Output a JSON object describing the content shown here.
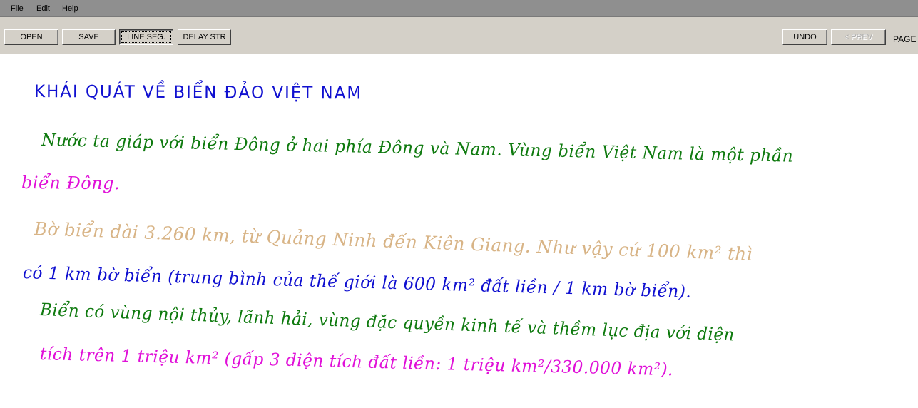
{
  "menu": {
    "file": "File",
    "edit": "Edit",
    "help": "Help"
  },
  "toolbar": {
    "open": "OPEN",
    "save": "SAVE",
    "line_seg": "LINE SEG.",
    "delay_str": "DELAY STR",
    "undo": "UNDO",
    "prev": "< PREV",
    "page": "PAGE"
  },
  "colors": {
    "blue": "#1010d0",
    "green": "#0f7a0f",
    "magenta": "#e010d8",
    "tan": "#d8b486"
  },
  "handwriting": {
    "title": "KHÁI QUÁT VỀ BIỂN ĐẢO VIỆT NAM",
    "line1": "Nước ta giáp với biển Đông ở hai phía Đông và Nam. Vùng biển Việt Nam là một phần",
    "line2": "biển Đông.",
    "line3": "Bờ biển dài 3.260 km, từ Quảng Ninh đến Kiên Giang. Như vậy cứ 100 km² thì",
    "line4": "có 1 km bờ biển (trung bình của thế giới là 600 km² đất liền / 1 km bờ biển).",
    "line5": "Biển có vùng nội thủy, lãnh hải, vùng đặc quyền kinh tế và thềm lục địa với diện",
    "line6": "tích trên 1 triệu km² (gấp 3 diện tích đất liền: 1 triệu km²/330.000 km²)."
  }
}
